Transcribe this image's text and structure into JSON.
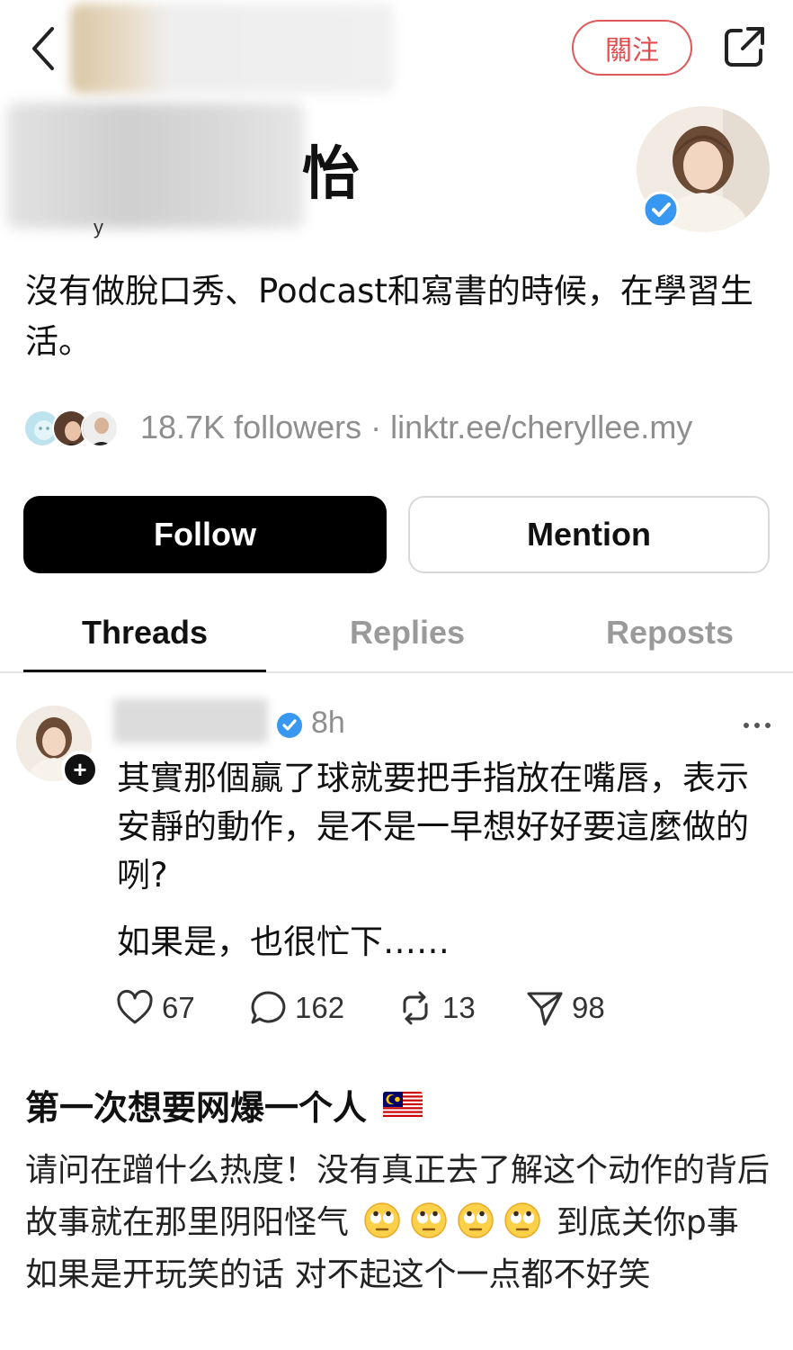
{
  "topbar": {
    "follow_cn_label": "關注"
  },
  "profile": {
    "name_visible_part": "怡",
    "handle_stub": "y",
    "bio": "沒有做脫口秀、Podcast和寫書的時候，在學習生活。",
    "followers": "18.7K followers",
    "separator": "·",
    "link": "linktr.ee/cheryllee.my"
  },
  "buttons": {
    "follow": "Follow",
    "mention": "Mention"
  },
  "tabs": [
    {
      "label": "Threads",
      "active": true
    },
    {
      "label": "Replies",
      "active": false
    },
    {
      "label": "Reposts",
      "active": false
    }
  ],
  "post": {
    "time": "8h",
    "plus": "+",
    "paragraph1": "其實那個贏了球就要把手指放在嘴唇，表示安靜的動作，是不是一早想好好要這麼做的咧?",
    "paragraph2": "如果是，也很忙下……",
    "stats": {
      "likes": "67",
      "replies": "162",
      "reposts": "13",
      "shares": "98"
    }
  },
  "quoted": {
    "title": "第一次想要网爆一个人",
    "flag_icon": "malaysia-flag-icon",
    "line1": "请问在蹭什么热度！没有真正去了解这个动作的背后故事就在那里阴阳怪气",
    "line1_end": "到底关你p事",
    "line2": "如果是开玩笑的话 对不起这个一点都不好笑",
    "emoji_icon": "eye-roll-emoji-icon",
    "emoji_count": 4
  },
  "colors": {
    "accent_red": "#e34b4d",
    "verified_blue": "#3897f0",
    "muted_gray": "#8e8e8e"
  }
}
